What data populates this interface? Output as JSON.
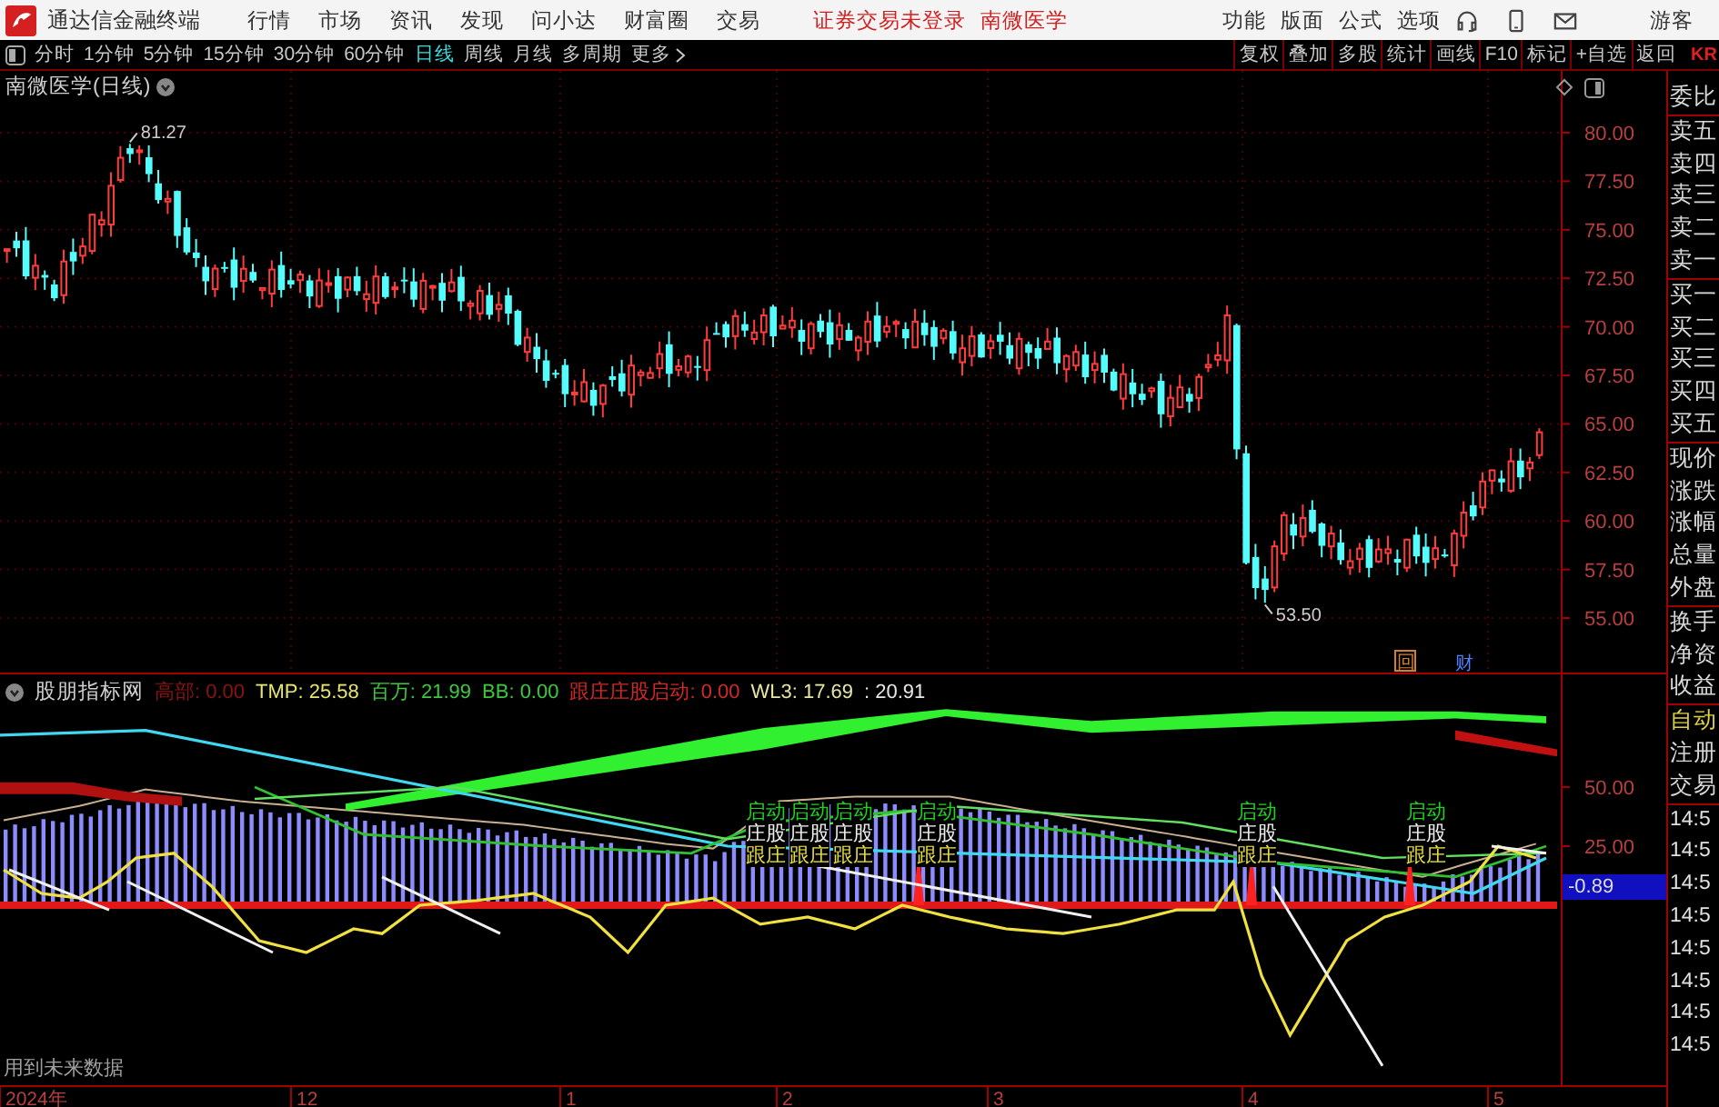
{
  "topbar": {
    "title": "通达信金融终端",
    "menu": [
      "行情",
      "市场",
      "资讯",
      "发现",
      "问小达",
      "财富圈",
      "交易"
    ],
    "login_status": "证券交易未登录",
    "stock": "南微医学",
    "right_menu": [
      "功能",
      "版面",
      "公式",
      "选项"
    ],
    "user": "游客"
  },
  "periods": [
    {
      "label": "分时",
      "selected": false
    },
    {
      "label": "1分钟",
      "selected": false
    },
    {
      "label": "5分钟",
      "selected": false
    },
    {
      "label": "15分钟",
      "selected": false
    },
    {
      "label": "30分钟",
      "selected": false
    },
    {
      "label": "60分钟",
      "selected": false
    },
    {
      "label": "日线",
      "selected": true
    },
    {
      "label": "周线",
      "selected": false
    },
    {
      "label": "月线",
      "selected": false
    },
    {
      "label": "多周期",
      "selected": false
    },
    {
      "label": "更多",
      "selected": false
    }
  ],
  "tools": [
    "复权",
    "叠加",
    "多股",
    "统计",
    "画线",
    "F10",
    "标记",
    "+自选",
    "返回"
  ],
  "corner_label": "KR",
  "chart": {
    "title": "南微医学(日线)",
    "price_ticks": [
      "80.00",
      "77.50",
      "75.00",
      "72.50",
      "70.00",
      "67.50",
      "65.00",
      "62.50",
      "60.00",
      "57.50",
      "55.00"
    ],
    "high_label": "81.27",
    "low_label": "53.50",
    "markers": [
      {
        "text": "回",
        "kind": "event"
      },
      {
        "text": "财",
        "kind": "finance"
      }
    ]
  },
  "indicator": {
    "name": "股朋指标网",
    "legend": [
      {
        "text": "高部: 0.00",
        "color": "#8a1414"
      },
      {
        "text": "TMP: 25.58",
        "color": "#e6e66e"
      },
      {
        "text": "百万: 21.99",
        "color": "#3cc83c"
      },
      {
        "text": "BB: 0.00",
        "color": "#3cc83c"
      },
      {
        "text": "跟庄庄股启动: 0.00",
        "color": "#d22828"
      },
      {
        "text": "WL3: 17.69",
        "color": "#e6e6a0"
      },
      {
        "text": ": 20.91",
        "color": "#e6e6e6"
      }
    ],
    "ticks": [
      "50.00",
      "25.00"
    ],
    "current": "-0.89",
    "signals": [
      {
        "lines": [
          "启动",
          "庄股",
          "跟庄"
        ]
      },
      {
        "lines": [
          "启动",
          "庄股",
          "跟庄"
        ]
      },
      {
        "lines": [
          "启动",
          "庄股",
          "跟庄"
        ]
      },
      {
        "lines": [
          "启动",
          "庄股",
          "跟庄"
        ]
      },
      {
        "lines": [
          "启动",
          "庄股",
          "跟庄"
        ]
      },
      {
        "lines": [
          "启动",
          "庄股",
          "跟庄"
        ]
      }
    ],
    "note": "用到未来数据"
  },
  "x_axis": [
    "2024年",
    "12",
    "1",
    "2",
    "3",
    "4",
    "5"
  ],
  "sidebar": {
    "groups": [
      {
        "items": [
          {
            "text": "委比",
            "kind": "field"
          }
        ]
      },
      {
        "items": [
          {
            "text": "卖五",
            "kind": "field"
          },
          {
            "text": "卖四",
            "kind": "field"
          },
          {
            "text": "卖三",
            "kind": "field"
          },
          {
            "text": "卖二",
            "kind": "field"
          },
          {
            "text": "卖一",
            "kind": "field"
          }
        ]
      },
      {
        "items": [
          {
            "text": "买一",
            "kind": "field"
          },
          {
            "text": "买二",
            "kind": "field"
          },
          {
            "text": "买三",
            "kind": "field"
          },
          {
            "text": "买四",
            "kind": "field"
          },
          {
            "text": "买五",
            "kind": "field"
          }
        ]
      },
      {
        "items": [
          {
            "text": "现价",
            "kind": "field"
          },
          {
            "text": "涨跌",
            "kind": "field"
          },
          {
            "text": "涨幅",
            "kind": "field"
          },
          {
            "text": "总量",
            "kind": "field"
          },
          {
            "text": "外盘",
            "kind": "field"
          }
        ]
      },
      {
        "items": [
          {
            "text": "换手",
            "kind": "field"
          },
          {
            "text": "净资",
            "kind": "field"
          },
          {
            "text": "收益",
            "kind": "field"
          }
        ]
      },
      {
        "items": [
          {
            "text": "自动",
            "kind": "accent"
          },
          {
            "text": "注册",
            "kind": "field"
          },
          {
            "text": "交易",
            "kind": "field"
          }
        ]
      },
      {
        "items": [
          {
            "text": "14:5",
            "kind": "time"
          },
          {
            "text": "14:5",
            "kind": "time"
          },
          {
            "text": "14:5",
            "kind": "time"
          },
          {
            "text": "14:5",
            "kind": "time"
          },
          {
            "text": "14:5",
            "kind": "time"
          },
          {
            "text": "14:5",
            "kind": "time"
          },
          {
            "text": "14:5",
            "kind": "time"
          },
          {
            "text": "14:5",
            "kind": "time"
          }
        ]
      }
    ]
  }
}
